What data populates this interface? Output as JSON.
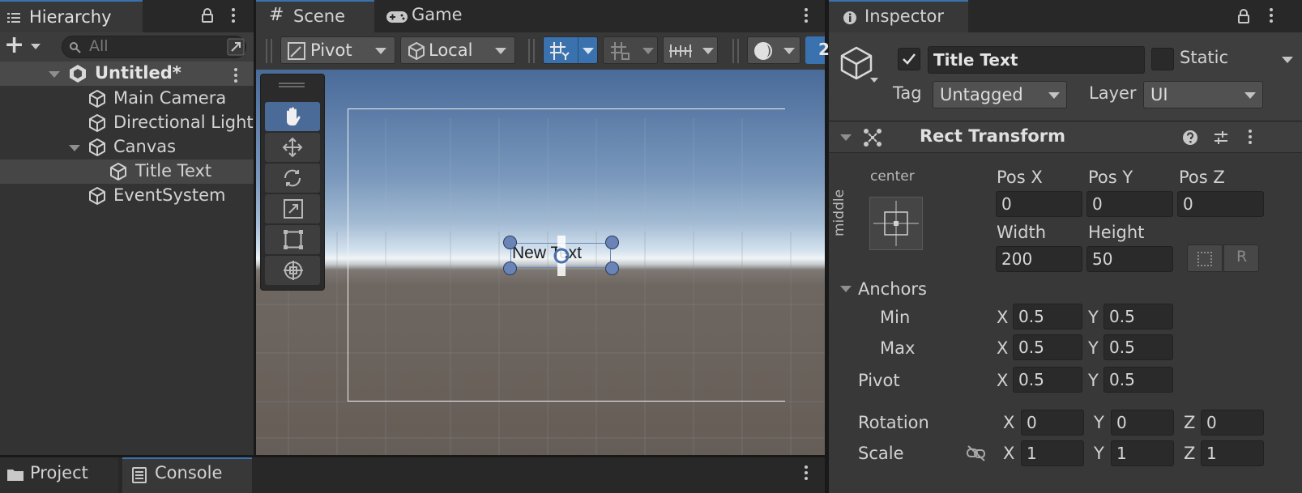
{
  "hierarchy": {
    "tab_title": "Hierarchy",
    "search_placeholder": "All",
    "add_symbol": "+",
    "scene_name": "Untitled*",
    "items": [
      {
        "label": "Main Camera"
      },
      {
        "label": "Directional Light"
      },
      {
        "label": "Canvas"
      },
      {
        "label": "Title Text"
      },
      {
        "label": "EventSystem"
      }
    ]
  },
  "bottom_tabs": {
    "project": "Project",
    "console": "Console"
  },
  "scene_view": {
    "tab_scene": "Scene",
    "tab_game": "Game",
    "pivot_dropdown": "Pivot",
    "space_dropdown": "Local",
    "text_object": "New Text",
    "partial_button": "2"
  },
  "inspector": {
    "tab_title": "Inspector",
    "object_name": "Title Text",
    "active": true,
    "static_label": "Static",
    "tag_label": "Tag",
    "tag_value": "Untagged",
    "layer_label": "Layer",
    "layer_value": "UI",
    "component_title": "Rect Transform",
    "anchor_preset_h": "center",
    "anchor_preset_v": "middle",
    "pos_x_label": "Pos X",
    "pos_y_label": "Pos Y",
    "pos_z_label": "Pos Z",
    "pos_x": "0",
    "pos_y": "0",
    "pos_z": "0",
    "width_label": "Width",
    "height_label": "Height",
    "width": "200",
    "height": "50",
    "raw_button": "R",
    "anchors_label": "Anchors",
    "min_label": "Min",
    "max_label": "Max",
    "pivot_label": "Pivot",
    "x_label": "X",
    "y_label": "Y",
    "z_label": "Z",
    "anchor_min_x": "0.5",
    "anchor_min_y": "0.5",
    "anchor_max_x": "0.5",
    "anchor_max_y": "0.5",
    "pivot_x": "0.5",
    "pivot_y": "0.5",
    "rotation_label": "Rotation",
    "rotation_x": "0",
    "rotation_y": "0",
    "rotation_z": "0",
    "scale_label": "Scale",
    "scale_x": "1",
    "scale_y": "1",
    "scale_z": "1"
  },
  "colors": {
    "accent": "#3a72b0",
    "selection": "#464646",
    "panel": "#383838"
  }
}
